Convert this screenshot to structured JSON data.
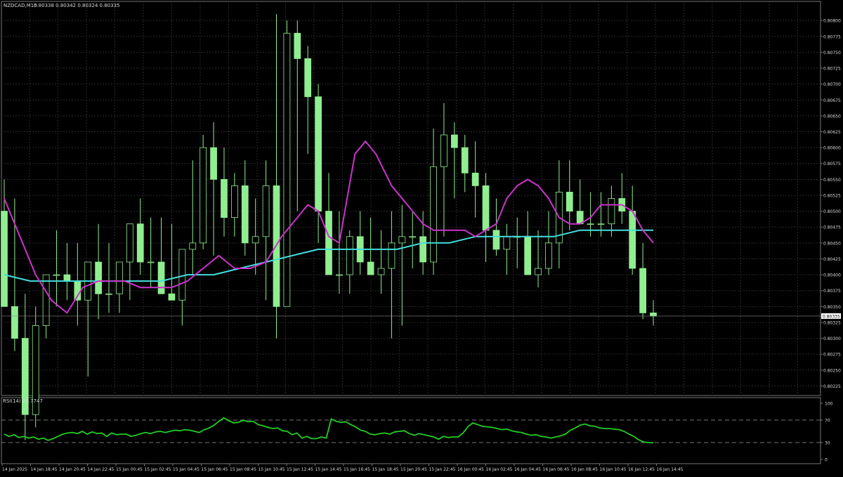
{
  "header": {
    "symbol_text": "NZDCAD,M15",
    "ohlc_text": "0.80338 0.80342 0.80324 0.80335"
  },
  "colors": {
    "background": "#000000",
    "grid": "#2a2a2a",
    "axis_text": "#d8d8d8",
    "candle": "#90ee90",
    "ma_fast": "#cc33cc",
    "ma_slow": "#44dddd",
    "rsi_line": "#22cc22",
    "price_marker_bg": "#ffffff",
    "price_marker_text": "#000000"
  },
  "chart_data": [
    {
      "type": "candlestick",
      "title": "NZDCAD,M15",
      "ylim": [
        0.8021,
        0.8083
      ],
      "y_ticks": [
        "0.80800",
        "0.80775",
        "0.80750",
        "0.80725",
        "0.80700",
        "0.80675",
        "0.80650",
        "0.80625",
        "0.80600",
        "0.80575",
        "0.80550",
        "0.80525",
        "0.80500",
        "0.80475",
        "0.80450",
        "0.80425",
        "0.80400",
        "0.80375",
        "0.80350",
        "0.80325",
        "0.80300",
        "0.80275",
        "0.80250",
        "0.80225"
      ],
      "current_price_label": "0.80335",
      "candles": {
        "open": [
          0.805,
          0.8035,
          0.803,
          0.8018,
          0.8032,
          0.804,
          0.804,
          0.8039,
          0.8036,
          0.8042,
          0.8037,
          0.8037,
          0.8042,
          0.8048,
          0.8042,
          0.8042,
          0.8037,
          0.8036,
          0.8044,
          0.8045,
          0.806,
          0.8055,
          0.8049,
          0.8054,
          0.8045,
          0.8046,
          0.8054,
          0.8035,
          0.8078,
          0.8074,
          0.8068,
          0.805,
          0.804,
          0.804,
          0.8046,
          0.8042,
          0.804,
          0.8041,
          0.8045,
          0.8046,
          0.8046,
          0.8042,
          0.8057,
          0.8062,
          0.806,
          0.8056,
          0.8054,
          0.8047,
          0.8044,
          0.8046,
          0.8046,
          0.804,
          0.8041,
          0.8045,
          0.8053,
          0.805,
          0.8048,
          0.8048,
          0.8048,
          0.8052,
          0.805,
          0.8041,
          0.8034
        ],
        "high": [
          0.8055,
          0.8052,
          0.8037,
          0.8035,
          0.804,
          0.8047,
          0.8045,
          0.8045,
          0.8042,
          0.8048,
          0.8045,
          0.8042,
          0.8047,
          0.8052,
          0.8049,
          0.8049,
          0.8048,
          0.8044,
          0.8058,
          0.8062,
          0.8064,
          0.806,
          0.8056,
          0.8058,
          0.8052,
          0.8058,
          0.8081,
          0.808,
          0.808,
          0.8076,
          0.807,
          0.8056,
          0.805,
          0.8047,
          0.805,
          0.8049,
          0.8047,
          0.805,
          0.8051,
          0.805,
          0.805,
          0.8063,
          0.8067,
          0.8064,
          0.8062,
          0.8061,
          0.8056,
          0.8052,
          0.8048,
          0.8049,
          0.805,
          0.8047,
          0.805,
          0.8058,
          0.8058,
          0.8055,
          0.8053,
          0.8053,
          0.8054,
          0.8056,
          0.8054,
          0.8045,
          0.8036
        ],
        "low": [
          0.804,
          0.8028,
          0.8014,
          0.8016,
          0.803,
          0.8035,
          0.8036,
          0.8032,
          0.8024,
          0.8033,
          0.8034,
          0.8034,
          0.8036,
          0.804,
          0.8038,
          0.8039,
          0.8036,
          0.8032,
          0.804,
          0.8044,
          0.8043,
          0.8046,
          0.8046,
          0.8043,
          0.804,
          0.8036,
          0.803,
          0.8035,
          0.805,
          0.8059,
          0.8045,
          0.804,
          0.8037,
          0.8037,
          0.804,
          0.804,
          0.8037,
          0.803,
          0.8032,
          0.8041,
          0.804,
          0.804,
          0.8046,
          0.8052,
          0.8053,
          0.8049,
          0.8042,
          0.8043,
          0.804,
          0.8041,
          0.8041,
          0.8038,
          0.804,
          0.8041,
          0.8047,
          0.8048,
          0.8046,
          0.8046,
          0.8046,
          0.8048,
          0.804,
          0.8033,
          0.8032
        ],
        "close": [
          0.8035,
          0.803,
          0.8018,
          0.8032,
          0.804,
          0.804,
          0.8039,
          0.8036,
          0.8042,
          0.8037,
          0.8037,
          0.8042,
          0.8048,
          0.8042,
          0.8042,
          0.8037,
          0.8036,
          0.8044,
          0.8045,
          0.806,
          0.8055,
          0.8049,
          0.8054,
          0.8045,
          0.8046,
          0.8054,
          0.8035,
          0.8078,
          0.8074,
          0.8068,
          0.805,
          0.804,
          0.804,
          0.8046,
          0.8042,
          0.804,
          0.8041,
          0.8045,
          0.8046,
          0.8046,
          0.8042,
          0.8057,
          0.8062,
          0.806,
          0.8056,
          0.8054,
          0.8047,
          0.8044,
          0.8046,
          0.8046,
          0.804,
          0.8041,
          0.8045,
          0.8053,
          0.805,
          0.8048,
          0.8048,
          0.8048,
          0.8052,
          0.805,
          0.8041,
          0.8034,
          0.80335
        ]
      },
      "ma_fast": [
        0.8052,
        0.8046,
        0.804,
        0.8036,
        0.8034,
        0.8038,
        0.8039,
        0.8039,
        0.8039,
        0.8038,
        0.8038,
        0.8038,
        0.8039,
        0.8041,
        0.8043,
        0.8041,
        0.8041,
        0.8042,
        0.8046,
        0.8049,
        0.8051,
        0.805,
        0.8046,
        0.8045,
        0.8059,
        0.8061,
        0.8059,
        0.8054,
        0.8051,
        0.8048,
        0.8047,
        0.8047,
        0.8047,
        0.8047,
        0.8046,
        0.8047,
        0.8048,
        0.8052,
        0.8054,
        0.8055,
        0.8054,
        0.8052,
        0.8049,
        0.8048,
        0.8048,
        0.8049,
        0.8051,
        0.8051,
        0.8051,
        0.805,
        0.8047,
        0.8045
      ],
      "ma_fast_x": [
        0,
        6,
        12,
        18,
        24,
        30,
        36,
        40,
        46,
        52,
        58,
        64,
        70,
        76,
        82,
        88,
        94,
        100,
        106,
        112,
        116,
        120,
        124,
        128,
        134,
        138,
        142,
        148,
        154,
        160,
        164,
        168,
        172,
        176,
        180,
        184,
        188,
        192,
        196,
        200,
        204,
        208,
        212,
        216,
        220,
        224,
        228,
        232,
        236,
        240,
        244,
        248
      ],
      "ma_slow": [
        0.804,
        0.8039,
        0.8039,
        0.8039,
        0.8039,
        0.8039,
        0.8039,
        0.804,
        0.804,
        0.8041,
        0.8042,
        0.8043,
        0.8044,
        0.8044,
        0.8044,
        0.8044,
        0.8045,
        0.8045,
        0.8046,
        0.8046,
        0.8046,
        0.8046,
        0.8047,
        0.8047,
        0.8047,
        0.8047,
        0.8047
      ],
      "ma_slow_x": [
        0,
        10,
        20,
        30,
        40,
        50,
        60,
        70,
        80,
        90,
        100,
        110,
        120,
        130,
        140,
        150,
        160,
        170,
        180,
        190,
        200,
        210,
        220,
        230,
        240,
        244,
        248
      ]
    },
    {
      "type": "line",
      "title": "RSI(14) 29.7747",
      "ylim": [
        0,
        100
      ],
      "y_ticks": [
        "100",
        "70",
        "30",
        "0"
      ],
      "levels": [
        70,
        30
      ],
      "series": [
        {
          "values": [
            45,
            41,
            44,
            39,
            41,
            38,
            40,
            36,
            38,
            34,
            37,
            41,
            45,
            47,
            48,
            46,
            50,
            45,
            49,
            46,
            47,
            41,
            47,
            44,
            45,
            45,
            41,
            43,
            46,
            48,
            46,
            49,
            50,
            48,
            50,
            52,
            51,
            53,
            52,
            50,
            48,
            53,
            56,
            61,
            68,
            74,
            69,
            65,
            66,
            70,
            67,
            68,
            62,
            60,
            57,
            55,
            56,
            51,
            50,
            44,
            47,
            38,
            41,
            37,
            37,
            40,
            38,
            72,
            68,
            66,
            67,
            62,
            58,
            52,
            50,
            45,
            44,
            46,
            47,
            45,
            49,
            50,
            51,
            46,
            43,
            46,
            44,
            42,
            40,
            36,
            41,
            39,
            40,
            40,
            47,
            58,
            65,
            62,
            59,
            58,
            57,
            55,
            53,
            54,
            51,
            49,
            48,
            45,
            43,
            44,
            41,
            40,
            38,
            40,
            42,
            45,
            52,
            56,
            61,
            63,
            60,
            59,
            56,
            55,
            55,
            54,
            53,
            50,
            45,
            41,
            35,
            31,
            30,
            29.7747
          ]
        }
      ],
      "current_value": "29.7747"
    }
  ],
  "x_axis": {
    "labels": [
      "14 Jan 2025",
      "14 Jan 18:45",
      "14 Jan 20:45",
      "14 Jan 22:45",
      "15 Jan 00:45",
      "15 Jan 02:45",
      "15 Jan 04:45",
      "15 Jan 06:45",
      "15 Jan 08:45",
      "15 Jan 10:45",
      "15 Jan 12:45",
      "15 Jan 14:45",
      "15 Jan 16:45",
      "15 Jan 18:45",
      "15 Jan 20:45",
      "15 Jan 22:45",
      "16 Jan 00:45",
      "16 Jan 02:45",
      "16 Jan 04:45",
      "16 Jan 06:45",
      "16 Jan 08:45",
      "16 Jan 10:45",
      "16 Jan 12:45",
      "16 Jan 14:45"
    ]
  }
}
